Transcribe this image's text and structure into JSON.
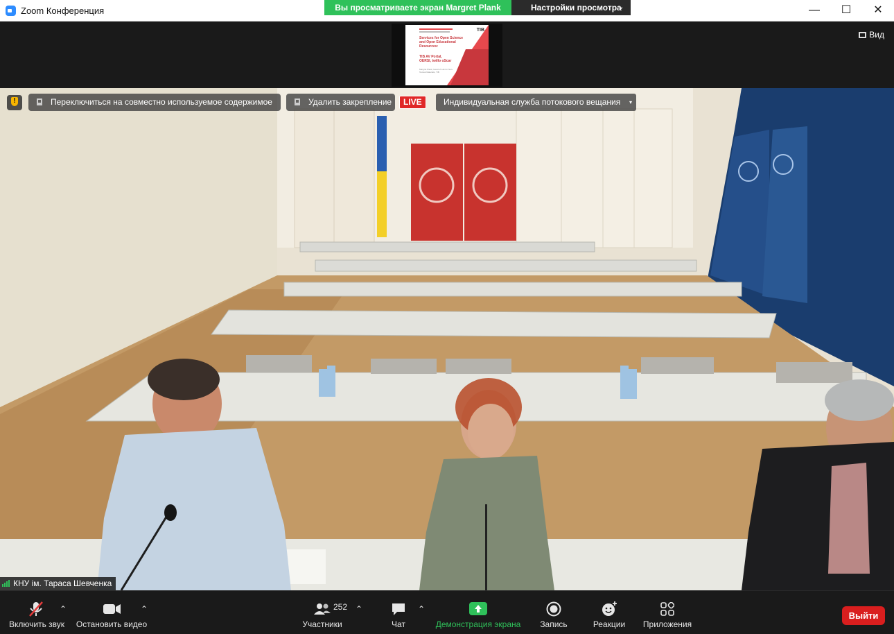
{
  "window": {
    "title": "Zoom Конференция",
    "minimize_glyph": "—",
    "maximize_glyph": "☐",
    "close_glyph": "✕"
  },
  "share_banner": {
    "viewing_text": "Вы просматриваете экран Margret Plank",
    "view_options_label": "Настройки просмотра",
    "view_options_caret": "⌄"
  },
  "shared_slide": {
    "logo_text": "TIB",
    "title_text": "Services for Open Science and Open Educational Resources:",
    "subtitle_text": "TIB AV Portal, OERSI, twillo oScar",
    "author_text": "Margret Plank, Head of Lab for Non-Textual Materials, TIB"
  },
  "view_button": {
    "label": "Вид",
    "icon": "grid-icon"
  },
  "video_overlay": {
    "security_icon": "shield-icon",
    "switch_content_label": "Переключиться на совместно используемое содержимое",
    "unpin_label": "Удалить закрепление",
    "live_badge": "LIVE",
    "stream_service_label": "Индивидуальная служба потокового вещания",
    "stream_caret": "▾"
  },
  "participant_name": "КНУ ім. Тараса Шевченка",
  "toolbar": {
    "unmute_label": "Включить звук",
    "stop_video_label": "Остановить видео",
    "participants_label": "Участники",
    "participants_count": "252",
    "chat_label": "Чат",
    "share_screen_label": "Демонстрация экрана",
    "record_label": "Запись",
    "reactions_label": "Реакции",
    "apps_label": "Приложения",
    "leave_label": "Выйти",
    "caret": "⌃"
  },
  "colors": {
    "share_green": "#2fc15a",
    "live_red": "#e02828",
    "leave_red": "#d91e1e",
    "toolbar_bg": "#1a1a1a"
  }
}
